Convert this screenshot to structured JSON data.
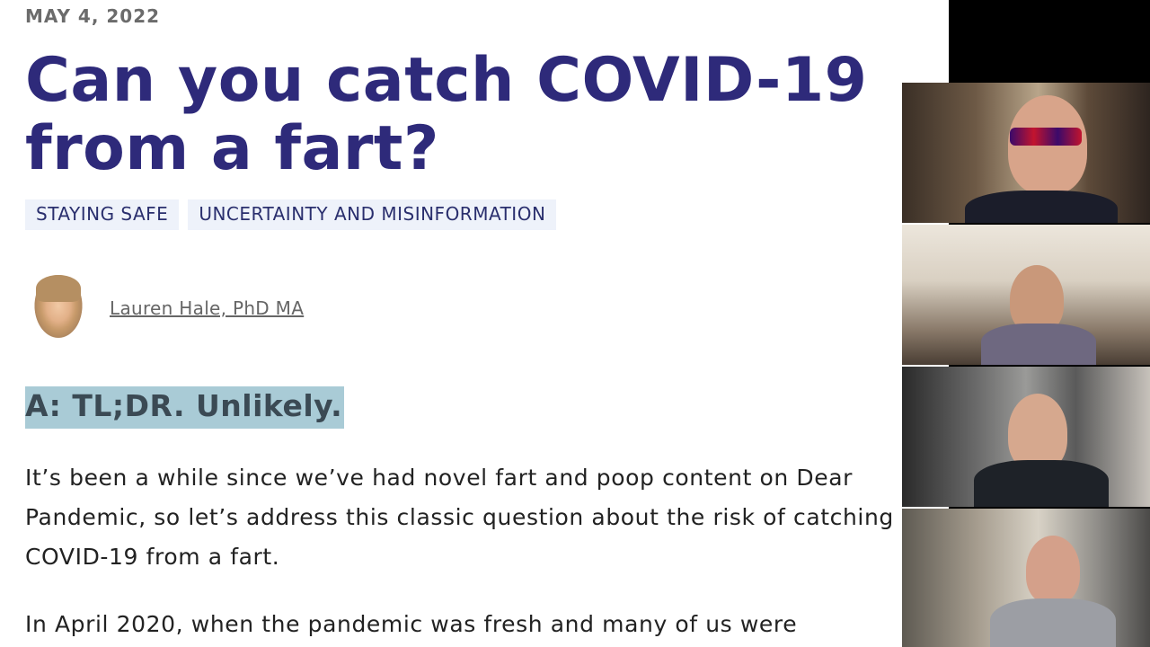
{
  "article": {
    "date": "MAY 4, 2022",
    "title": "Can you catch COVID-19 from a fart?",
    "tags": [
      "STAYING SAFE",
      "UNCERTAINTY AND MISINFORMATION"
    ],
    "author": "Lauren Hale, PhD MA",
    "answer_highlight": "A: TL;DR. Unlikely.",
    "paragraph_1": "It’s been a while since we’ve had novel fart and poop content on Dear Pandemic, so let’s address this classic question about the risk of catching COVID-19 from a fart.",
    "paragraph_2": "In April 2020, when the pandemic was fresh and many of us were"
  },
  "video_call": {
    "participant_count": 4
  },
  "colors": {
    "title": "#2e2a7a",
    "tag_bg": "#eef2fa",
    "highlight_bg": "#a9cbd6"
  }
}
